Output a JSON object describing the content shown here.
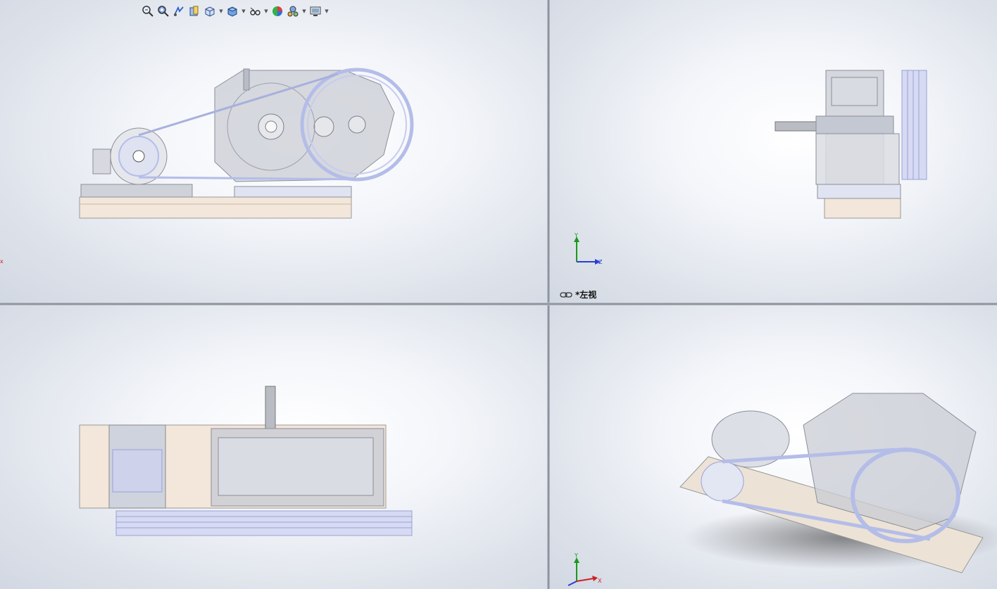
{
  "toolbar": {
    "items": [
      {
        "name": "zoom-to-fit-icon",
        "dropdown": false
      },
      {
        "name": "zoom-to-area-icon",
        "dropdown": false
      },
      {
        "name": "previous-view-icon",
        "dropdown": false
      },
      {
        "name": "section-view-icon",
        "dropdown": false
      },
      {
        "name": "view-orientation-icon",
        "dropdown": true
      },
      {
        "name": "display-style-icon",
        "dropdown": true
      },
      {
        "name": "hide-show-items-icon",
        "dropdown": true
      },
      {
        "name": "edit-appearance-icon",
        "dropdown": false
      },
      {
        "name": "apply-scene-icon",
        "dropdown": true
      },
      {
        "name": "view-settings-icon",
        "dropdown": true
      }
    ]
  },
  "viewports": {
    "top_right": {
      "label": "*左视"
    }
  },
  "triad": {
    "x": "X",
    "y": "Y",
    "z": "Z"
  },
  "colors": {
    "accent_red": "#cc2222",
    "axis_green": "#1a9a1a",
    "axis_blue": "#2a3fd0",
    "base_plate": "#f3e6da",
    "housing": "#c9ccd4",
    "belt": "#b4bde8"
  }
}
